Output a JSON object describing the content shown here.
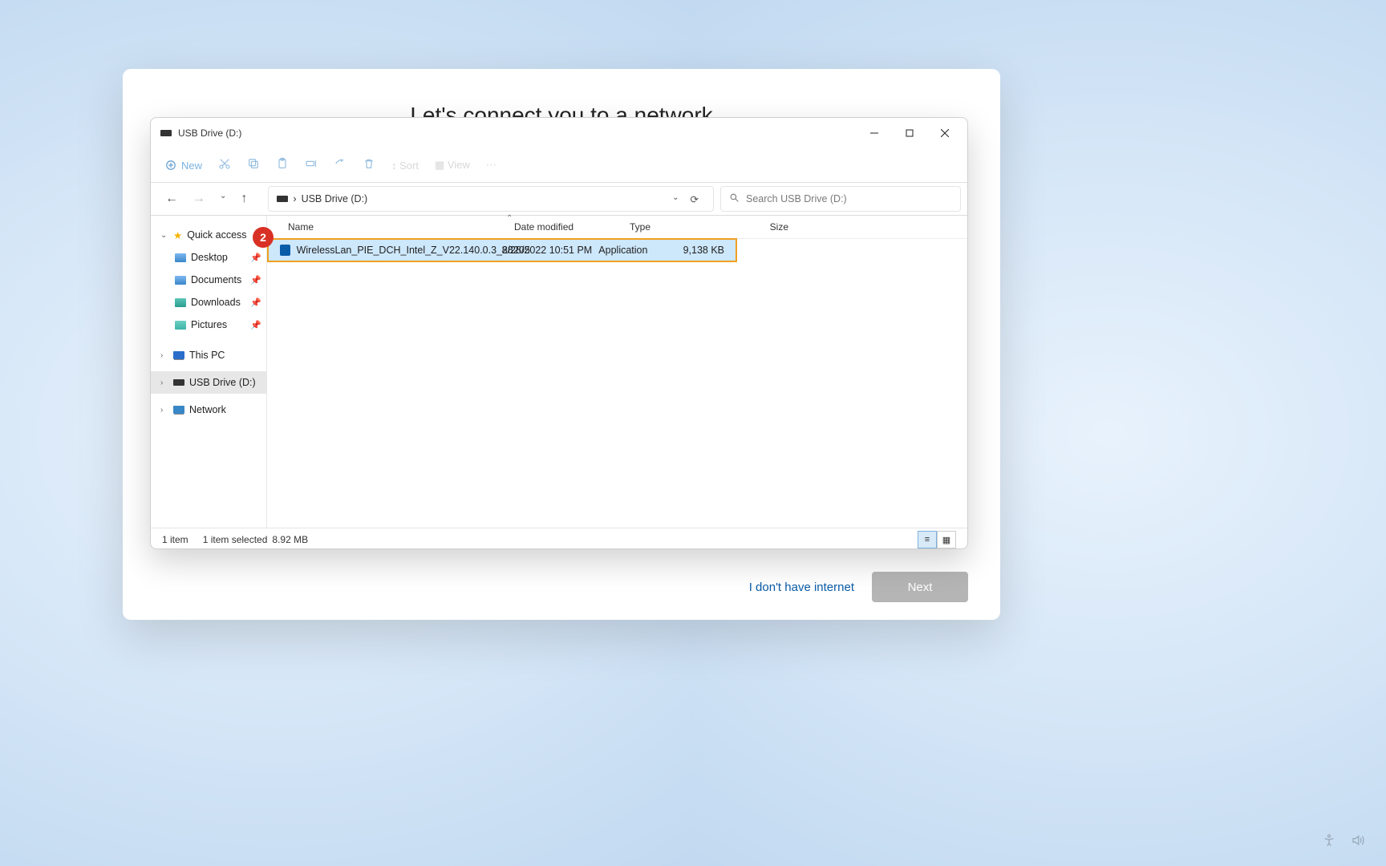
{
  "oobe": {
    "title": "Let's connect you to a network",
    "no_internet": "I don't have internet",
    "next": "Next"
  },
  "explorer": {
    "title": "USB Drive (D:)",
    "toolbar": {
      "new": "New",
      "sort": "Sort",
      "view": "View"
    },
    "addr": {
      "root": "›",
      "drive": "USB Drive (D:)"
    },
    "search_placeholder": "Search USB Drive (D:)",
    "side": {
      "quick": "Quick access",
      "desktop": "Desktop",
      "documents": "Documents",
      "downloads": "Downloads",
      "pictures": "Pictures",
      "thispc": "This PC",
      "usb": "USB Drive (D:)",
      "network": "Network"
    },
    "columns": {
      "name": "Name",
      "date": "Date modified",
      "type": "Type",
      "size": "Size"
    },
    "file": {
      "name": "WirelessLan_PIE_DCH_Intel_Z_V22.140.0.3_28205",
      "date": "8/28/2022 10:51 PM",
      "type": "Application",
      "size": "9,138 KB"
    },
    "status": {
      "count": "1 item",
      "selected": "1 item selected",
      "size": "8.92 MB"
    }
  },
  "callout_num": "2"
}
